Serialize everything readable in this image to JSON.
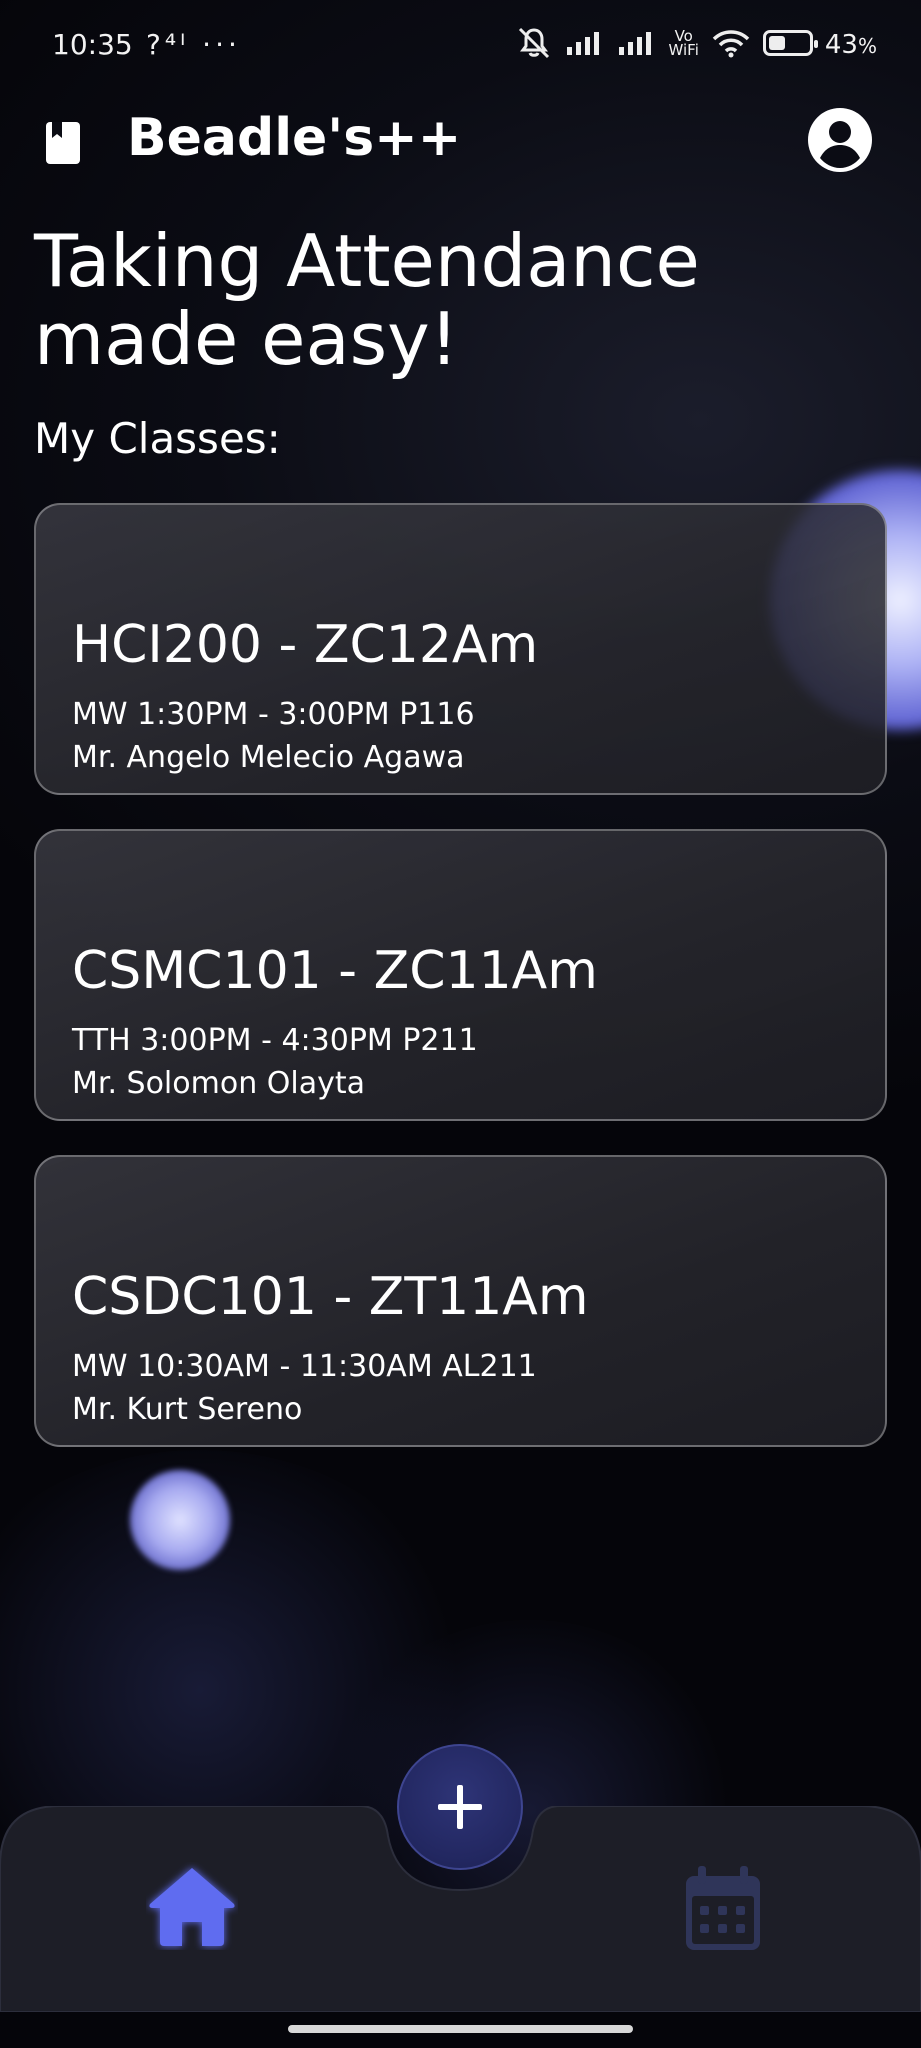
{
  "status_bar": {
    "time": "10:35",
    "left_icons": "?⁴ᴵ ···",
    "network_badge_top": "Vo",
    "network_badge_bottom": "WiFi",
    "battery_percent": "43",
    "battery_suffix": "%",
    "battery_level": 0.43
  },
  "app": {
    "title": "Beadle's++",
    "logo_icon": "book-icon",
    "profile_icon": "account-circle-icon"
  },
  "headline": "Taking Attendance made easy!",
  "section_title": "My Classes:",
  "classes": [
    {
      "code": "HCI200 - ZC12Am",
      "schedule": "MW 1:30PM - 3:00PM P116",
      "teacher": "Mr. Angelo Melecio Agawa"
    },
    {
      "code": "CSMC101 - ZC11Am",
      "schedule": "TTH 3:00PM - 4:30PM P211",
      "teacher": "Mr. Solomon Olayta"
    },
    {
      "code": "CSDC101 - ZT11Am",
      "schedule": "MW 10:30AM - 11:30AM AL211",
      "teacher": "Mr. Kurt Sereno"
    }
  ],
  "bottom_nav": {
    "fab_icon": "plus-icon",
    "items": [
      {
        "icon": "home-icon",
        "active": true
      },
      {
        "icon": "calendar-icon",
        "active": false
      }
    ]
  },
  "colors": {
    "accent": "#5e6cf0",
    "fab": "#262b6b",
    "nav_bg": "#1d1e27",
    "inactive_icon": "#2f3559"
  }
}
